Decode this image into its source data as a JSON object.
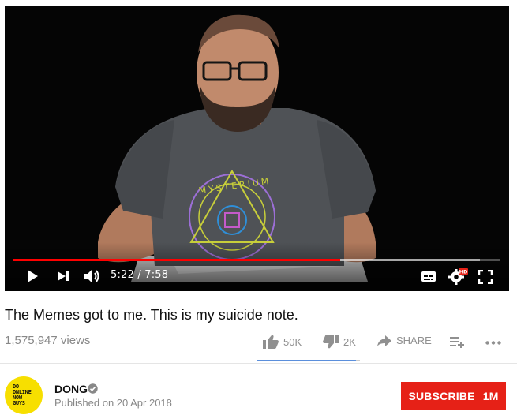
{
  "player": {
    "time_current": "5:22",
    "time_separator": " / ",
    "time_total": "7:58",
    "progress_played_fraction": 0.673,
    "progress_buffered_fraction": 0.96,
    "settings_badge": "HD",
    "shirt_text": "MYSTERIUM",
    "icons": [
      "play-icon",
      "next-icon",
      "volume-icon",
      "subtitles-icon",
      "settings-icon",
      "fullscreen-icon"
    ]
  },
  "video": {
    "title": "The Memes got to me. This is my suicide note.",
    "views": "1,575,947 views",
    "likes": "50K",
    "dislikes": "2K",
    "like_fraction": 0.96,
    "share_label": "SHARE"
  },
  "channel": {
    "name": "DONG",
    "published": "Published on 20 Apr 2018",
    "avatar_lines": [
      "DO",
      "ONLINE",
      "NOW",
      "GUYS"
    ],
    "subscribe_label": "SUBSCRIBE",
    "subscriber_count": "1M"
  },
  "colors": {
    "progress_played": "#ff0000",
    "subscribe_bg": "#e62117",
    "avatar_bg": "#f7df00",
    "sentiment_bar": "#5b8fdc"
  }
}
